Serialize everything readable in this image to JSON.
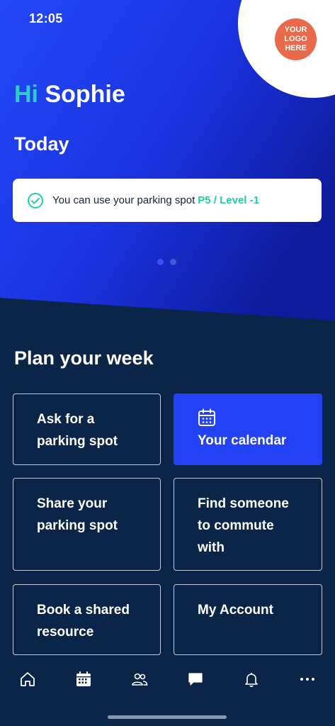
{
  "status_bar": {
    "time": "12:05"
  },
  "logo": {
    "line1": "YOUR",
    "line2": "LOGO",
    "line3": "HERE"
  },
  "greeting": {
    "hi": "Hi",
    "name": "Sophie"
  },
  "today": {
    "title": "Today",
    "notice_text": "You can use your parking spot",
    "notice_spot": "P5 / Level -1"
  },
  "carousel": {
    "pages": 2,
    "active": 1
  },
  "plan": {
    "title": "Plan your week",
    "tiles": [
      {
        "line1": "Ask for a",
        "line2": "parking spot",
        "line3": ""
      },
      {
        "line1": "Your calendar",
        "line2": "",
        "line3": ""
      },
      {
        "line1": "Share your",
        "line2": "parking spot",
        "line3": ""
      },
      {
        "line1": "Find someone",
        "line2": "to commute",
        "line3": "with"
      },
      {
        "line1": "Book a shared",
        "line2": "resource",
        "line3": ""
      },
      {
        "line1": "My Account",
        "line2": "",
        "line3": ""
      }
    ]
  },
  "colors": {
    "hero_gradient_start": "#1f3ef0",
    "hero_gradient_end": "#0f1fa8",
    "dark_bg": "#0b2548",
    "accent_teal": "#2ad0c7",
    "accent_green": "#1fcfa8",
    "primary_blue": "#2342f6",
    "logo_orange": "#e9694a"
  },
  "tabbar": {
    "items": [
      "home-icon",
      "calendar-icon",
      "people-icon",
      "chat-icon",
      "bell-icon",
      "more-icon"
    ]
  }
}
